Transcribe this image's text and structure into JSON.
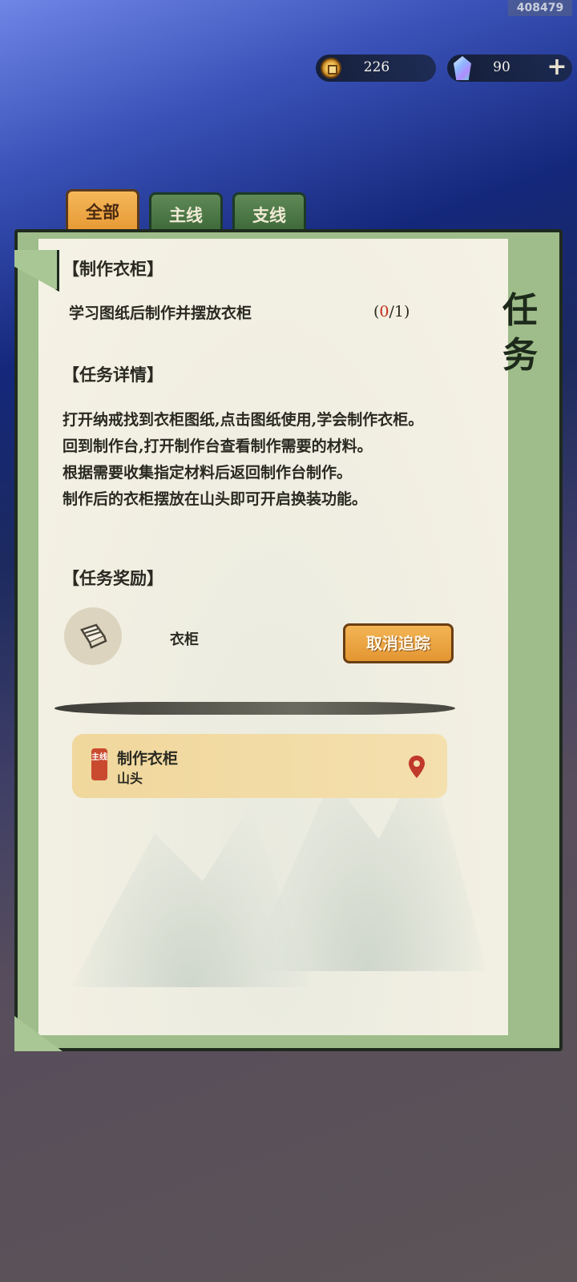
{
  "build_id": "408479",
  "currency": {
    "coins": "226",
    "gems": "90",
    "add_label": "+"
  },
  "tabs": [
    {
      "label": "全部",
      "active": true
    },
    {
      "label": "主线",
      "active": false
    },
    {
      "label": "支线",
      "active": false
    }
  ],
  "panel_title": "任务",
  "quest": {
    "title": "【制作衣柜】",
    "objective": "学习图纸后制作并摆放衣柜",
    "progress_open": "(",
    "progress_current": "0",
    "progress_total": "/1)",
    "details_heading": "【任务详情】",
    "details": [
      "打开纳戒找到衣柜图纸,点击图纸使用,学会制作衣柜。",
      "回到制作台,打开制作台查看制作需要的材料。",
      "根据需要收集指定材料后返回制作台制作。",
      "制作后的衣柜摆放在山头即可开启换装功能。"
    ],
    "reward_heading": "【任务奖励】",
    "reward_name": "衣柜",
    "reward_icon": "wardrobe-blueprint-icon",
    "untrack_button": "取消追踪"
  },
  "tracked": {
    "tag": "主线",
    "title": "制作衣柜",
    "location": "山头",
    "icon": "location-pin-icon"
  },
  "colors": {
    "accent_orange": "#e79a35",
    "tab_green": "#3e6a3a",
    "progress_red": "#c22a1a",
    "pin_red": "#c0392b"
  }
}
